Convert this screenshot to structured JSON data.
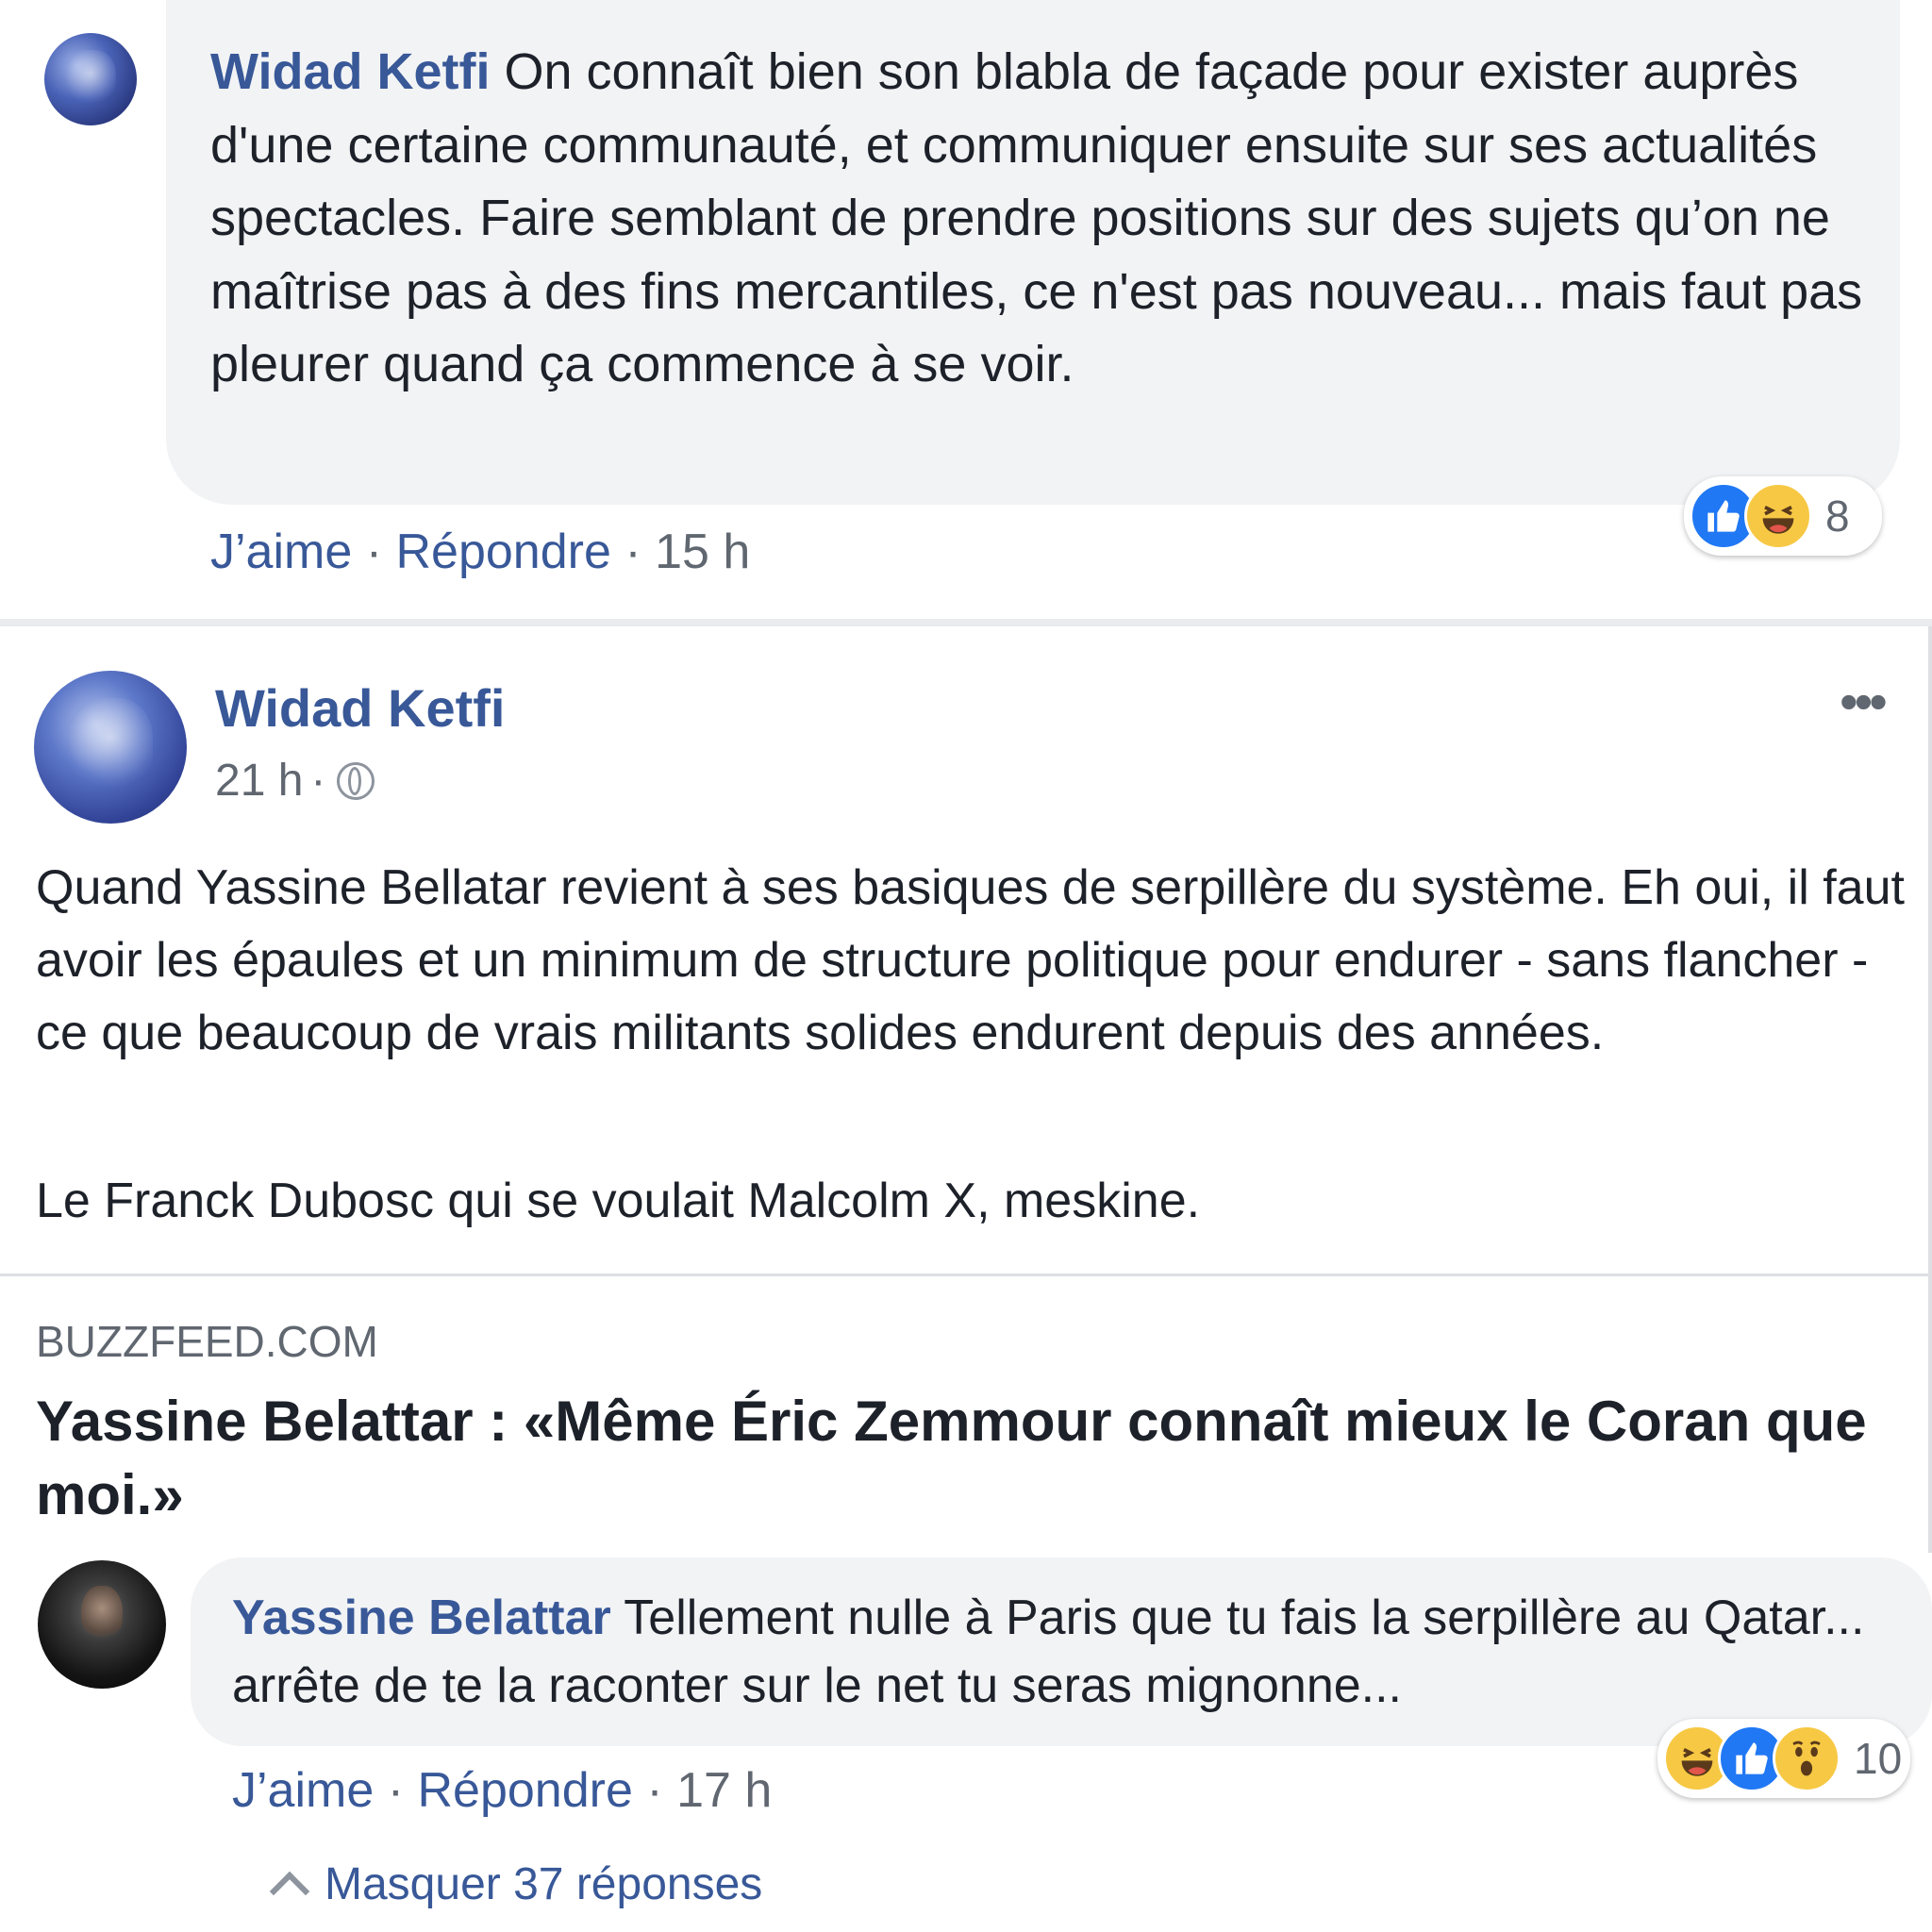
{
  "comment_top": {
    "author": "Widad Ketfi",
    "text": "On connaît bien son blabla de façade pour exister auprès d'une certaine communauté, et communiquer ensuite sur ses actualités spectacles. Faire semblant de prendre positions sur des sujets qu’on ne maîtrise pas à des fins mercantiles, ce n'est pas nouveau... mais faut pas pleurer quand ça commence à se voir.",
    "like_label": "J’aime",
    "reply_label": "Répondre",
    "separator": " · ",
    "time": "15 h",
    "reaction_count": "8",
    "reactions": [
      "like-icon",
      "haha-icon"
    ]
  },
  "post": {
    "author": "Widad Ketfi",
    "time": "21 h",
    "separator": " · ",
    "more_label": "•••",
    "paragraph_1": "Quand Yassine Bellatar revient à ses basiques de serpillère du système. Eh oui, il faut avoir les épaules et un minimum de structure politique pour endurer - sans flancher - ce que beaucoup de vrais militants solides endurent depuis des années.",
    "paragraph_2": "Le Franck Dubosc qui se voulait Malcolm X, meskine.",
    "link": {
      "domain": "BUZZFEED.COM",
      "title": "Yassine Belattar : «Même Éric Zemmour connaît mieux le Coran que moi.»"
    }
  },
  "comment_reply": {
    "author": "Yassine Belattar",
    "text": "Tellement nulle à Paris que tu fais la serpillère au Qatar... arrête de te la raconter sur le net tu seras mignonne...",
    "like_label": "J’aime",
    "reply_label": "Répondre",
    "separator": " · ",
    "time": "17 h",
    "reaction_count": "10",
    "reactions": [
      "haha-icon",
      "like-icon",
      "wow-icon"
    ]
  },
  "hide_replies_label": "Masquer 37 réponses",
  "colors": {
    "link_blue": "#385898",
    "bubble_gray": "#f2f3f5",
    "meta_gray": "#606770",
    "like_blue": "#2078f4",
    "emoji_yellow": "#f7c844"
  }
}
